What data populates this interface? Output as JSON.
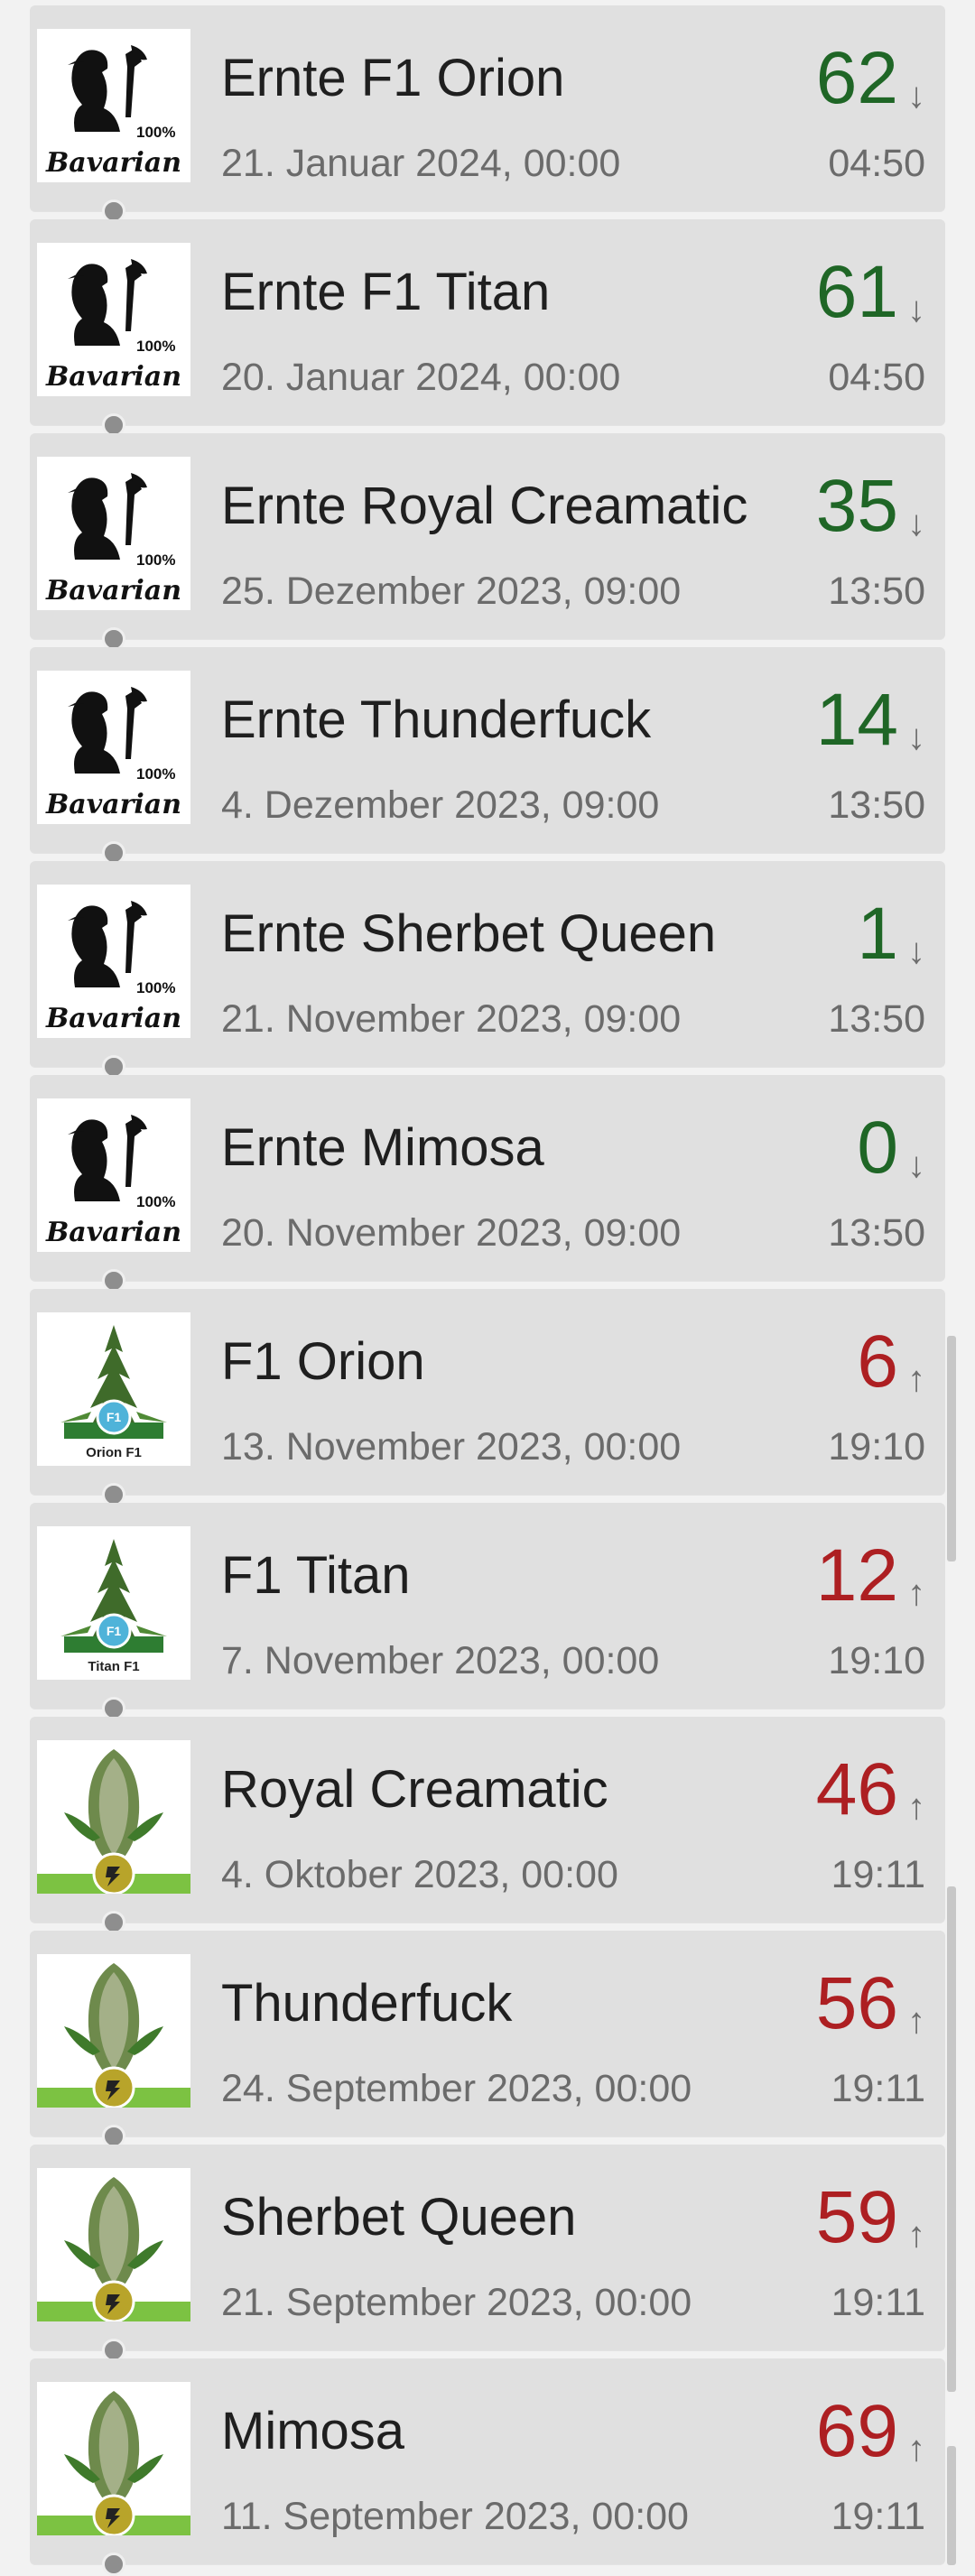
{
  "entries": [
    {
      "title": "Ernte F1 Orion",
      "date": "21. Januar 2024, 00:00",
      "count": "62",
      "arrow": "↓",
      "time": "04:50",
      "status": "green",
      "thumb": "bavarian-logo"
    },
    {
      "title": "Ernte F1 Titan",
      "date": "20. Januar 2024, 00:00",
      "count": "61",
      "arrow": "↓",
      "time": "04:50",
      "status": "green",
      "thumb": "bavarian-logo"
    },
    {
      "title": "Ernte Royal Creamatic",
      "date": "25. Dezember 2023, 09:00",
      "count": "35",
      "arrow": "↓",
      "time": "13:50",
      "status": "green",
      "thumb": "bavarian-logo"
    },
    {
      "title": "Ernte Thunderfuck",
      "date": "4. Dezember 2023, 09:00",
      "count": "14",
      "arrow": "↓",
      "time": "13:50",
      "status": "green",
      "thumb": "bavarian-logo"
    },
    {
      "title": "Ernte Sherbet Queen",
      "date": "21. November 2023, 09:00",
      "count": "1",
      "arrow": "↓",
      "time": "13:50",
      "status": "green",
      "thumb": "bavarian-logo"
    },
    {
      "title": "Ernte Mimosa",
      "date": "20. November 2023, 09:00",
      "count": "0",
      "arrow": "↓",
      "time": "13:50",
      "status": "green",
      "thumb": "bavarian-logo"
    },
    {
      "title": "F1 Orion",
      "date": "13. November 2023, 00:00",
      "count": "6",
      "arrow": "↑",
      "time": "19:10",
      "status": "red",
      "thumb": "plant-f1",
      "thumb_caption": "Orion F1"
    },
    {
      "title": "F1 Titan",
      "date": "7. November 2023, 00:00",
      "count": "12",
      "arrow": "↑",
      "time": "19:10",
      "status": "red",
      "thumb": "plant-f1",
      "thumb_caption": "Titan F1"
    },
    {
      "title": "Royal Creamatic",
      "date": "4. Oktober 2023, 00:00",
      "count": "46",
      "arrow": "↑",
      "time": "19:11",
      "status": "red",
      "thumb": "plant-bud"
    },
    {
      "title": "Thunderfuck",
      "date": "24. September 2023, 00:00",
      "count": "56",
      "arrow": "↑",
      "time": "19:11",
      "status": "red",
      "thumb": "plant-bud"
    },
    {
      "title": "Sherbet Queen",
      "date": "21. September 2023, 00:00",
      "count": "59",
      "arrow": "↑",
      "time": "19:11",
      "status": "red",
      "thumb": "plant-bud"
    },
    {
      "title": "Mimosa",
      "date": "11. September 2023, 00:00",
      "count": "69",
      "arrow": "↑",
      "time": "19:11",
      "status": "red",
      "thumb": "plant-bud"
    }
  ],
  "colors": {
    "green": "#1f6626",
    "red": "#ad1f22",
    "card": "#e0e0e0",
    "badge": "#7cc242"
  },
  "thumb_logo_text": {
    "percent": "100%",
    "word": "Bavarian"
  }
}
